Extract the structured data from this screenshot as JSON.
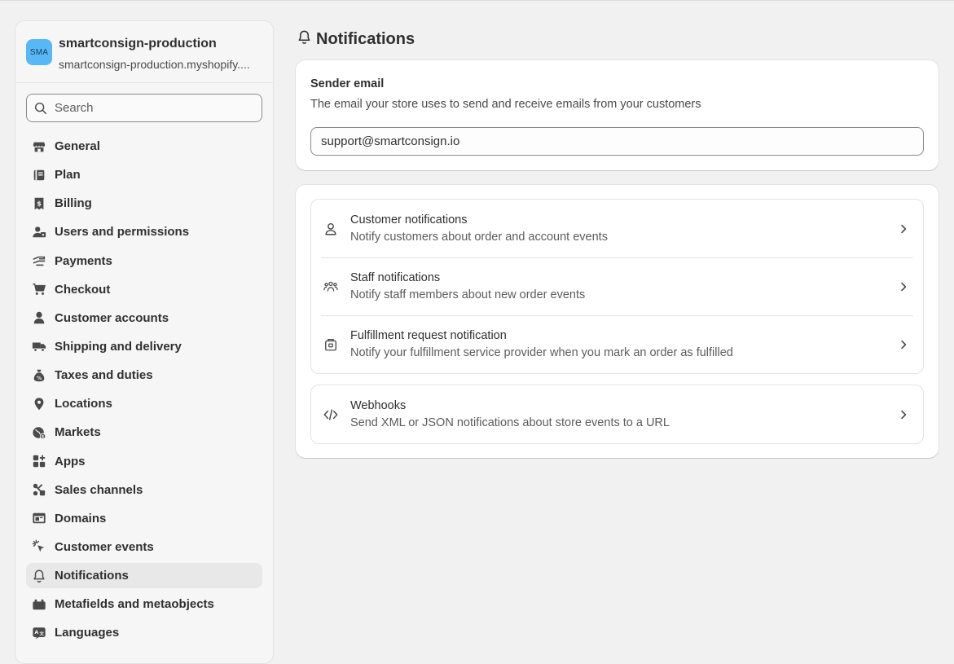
{
  "store": {
    "avatar_text": "SMA",
    "name": "smartconsign-production",
    "domain": "smartconsign-production.myshopify...."
  },
  "search": {
    "placeholder": "Search"
  },
  "sidebar": {
    "items": [
      {
        "label": "General",
        "icon": "store-icon"
      },
      {
        "label": "Plan",
        "icon": "plan-icon"
      },
      {
        "label": "Billing",
        "icon": "billing-icon"
      },
      {
        "label": "Users and permissions",
        "icon": "users-icon"
      },
      {
        "label": "Payments",
        "icon": "payments-icon"
      },
      {
        "label": "Checkout",
        "icon": "cart-icon"
      },
      {
        "label": "Customer accounts",
        "icon": "person-icon"
      },
      {
        "label": "Shipping and delivery",
        "icon": "truck-icon"
      },
      {
        "label": "Taxes and duties",
        "icon": "tax-icon"
      },
      {
        "label": "Locations",
        "icon": "location-icon"
      },
      {
        "label": "Markets",
        "icon": "globe-icon"
      },
      {
        "label": "Apps",
        "icon": "apps-icon"
      },
      {
        "label": "Sales channels",
        "icon": "sales-channels-icon"
      },
      {
        "label": "Domains",
        "icon": "domains-icon"
      },
      {
        "label": "Customer events",
        "icon": "cursor-icon"
      },
      {
        "label": "Notifications",
        "icon": "bell-icon",
        "active": true
      },
      {
        "label": "Metafields and metaobjects",
        "icon": "metafields-icon"
      },
      {
        "label": "Languages",
        "icon": "languages-icon"
      }
    ]
  },
  "page": {
    "title": "Notifications"
  },
  "sender": {
    "title": "Sender email",
    "description": "The email your store uses to send and receive emails from your customers",
    "value": "support@smartconsign.io"
  },
  "notifications": {
    "items": [
      {
        "title": "Customer notifications",
        "description": "Notify customers about order and account events"
      },
      {
        "title": "Staff notifications",
        "description": "Notify staff members about new order events"
      },
      {
        "title": "Fulfillment request notification",
        "description": "Notify your fulfillment service provider when you mark an order as fulfilled"
      }
    ],
    "webhooks": {
      "title": "Webhooks",
      "description": "Send XML or JSON notifications about store events to a URL"
    }
  }
}
